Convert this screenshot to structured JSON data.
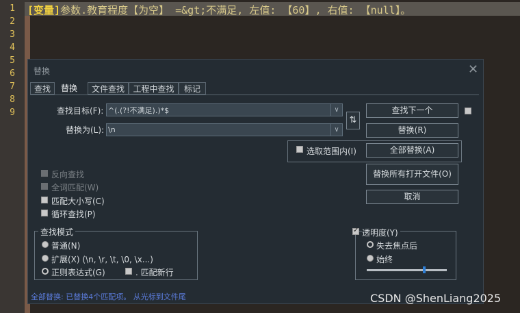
{
  "editor": {
    "line_numbers": [
      "1",
      "2",
      "3",
      "4",
      "5",
      "6",
      "7",
      "8",
      "9"
    ],
    "line1_keyword": "[变量]",
    "line1_text": "参数.教育程度【为空】 =&gt;不满足, 左值: 【60】, 右值: 【null】。"
  },
  "dialog": {
    "title": "替换",
    "close_glyph": "✕",
    "tabs": [
      {
        "label": "查找"
      },
      {
        "label": "替换"
      },
      {
        "label": "文件查找"
      },
      {
        "label": "工程中查找"
      },
      {
        "label": "标记"
      }
    ],
    "find_label": "查找目标(F):",
    "find_value": "^(.(?!不满足).)*$",
    "replace_label": "替换为(L):",
    "replace_value": "\\n",
    "swap_glyph": "⇅",
    "arrow_glyph": "∨",
    "buttons": {
      "find_next": "查找下一个",
      "replace": "替换(R)",
      "replace_all": "全部替换(A)",
      "replace_all_open": "替换所有打开文件(O)",
      "cancel": "取消"
    },
    "in_selection": "选取范围内(I)",
    "options": {
      "backward": "反向查找",
      "whole_word": "全词匹配(W)",
      "match_case": "匹配大小写(C)",
      "wrap": "循环查找(P)"
    },
    "search_mode": {
      "title": "查找模式",
      "normal": "普通(N)",
      "extended": "扩展(X) (\\n, \\r, \\t, \\0, \\x...)",
      "regex": "正则表达式(G)",
      "dot_newline": ". 匹配新行"
    },
    "transparency": {
      "title": "透明度(Y)",
      "on_lose_focus": "失去焦点后",
      "always": "始终",
      "value": 0.72
    },
    "status": "全部替换: 已替换4个匹配项。 从光标到文件尾"
  },
  "watermark": "CSDN @ShenLiang2025"
}
